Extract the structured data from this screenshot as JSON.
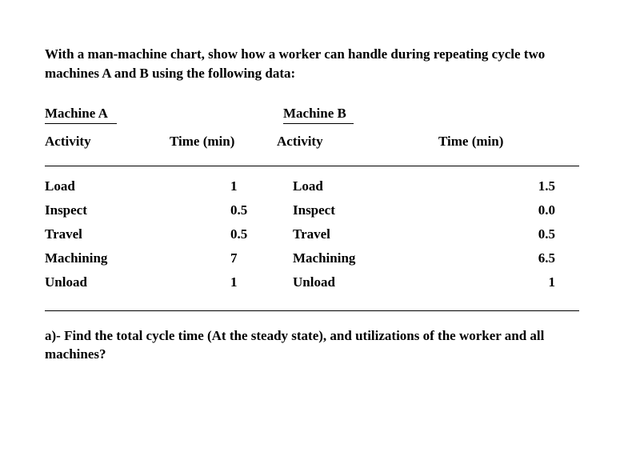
{
  "intro": "With a man-machine chart, show how a worker can handle during repeating cycle two machines A and B using the following data:",
  "headings": {
    "a": "Machine A",
    "b": "Machine B"
  },
  "colheads": {
    "activity": "Activity",
    "time": "Time (min)"
  },
  "rows": [
    {
      "act_a": "Load",
      "time_a": "1",
      "act_b": "Load",
      "time_b": "1.5"
    },
    {
      "act_a": "Inspect",
      "time_a": "0.5",
      "act_b": "Inspect",
      "time_b": "0.0"
    },
    {
      "act_a": "Travel",
      "time_a": "0.5",
      "act_b": "Travel",
      "time_b": "0.5"
    },
    {
      "act_a": "Machining",
      "time_a": "7",
      "act_b": "Machining",
      "time_b": "6.5"
    },
    {
      "act_a": "Unload",
      "time_a": "1",
      "act_b": "Unload",
      "time_b": "1"
    }
  ],
  "question": "a)- Find the total cycle time (At the steady state), and utilizations of the worker and all machines?",
  "chart_data": {
    "type": "table",
    "title": "Man-machine chart activity times for machines A and B",
    "series": [
      {
        "name": "Machine A",
        "activities": [
          "Load",
          "Inspect",
          "Travel",
          "Machining",
          "Unload"
        ],
        "times_min": [
          1,
          0.5,
          0.5,
          7,
          1
        ]
      },
      {
        "name": "Machine B",
        "activities": [
          "Load",
          "Inspect",
          "Travel",
          "Machining",
          "Unload"
        ],
        "times_min": [
          1.5,
          0.0,
          0.5,
          6.5,
          1
        ]
      }
    ],
    "xlabel": "Activity",
    "ylabel": "Time (min)"
  }
}
